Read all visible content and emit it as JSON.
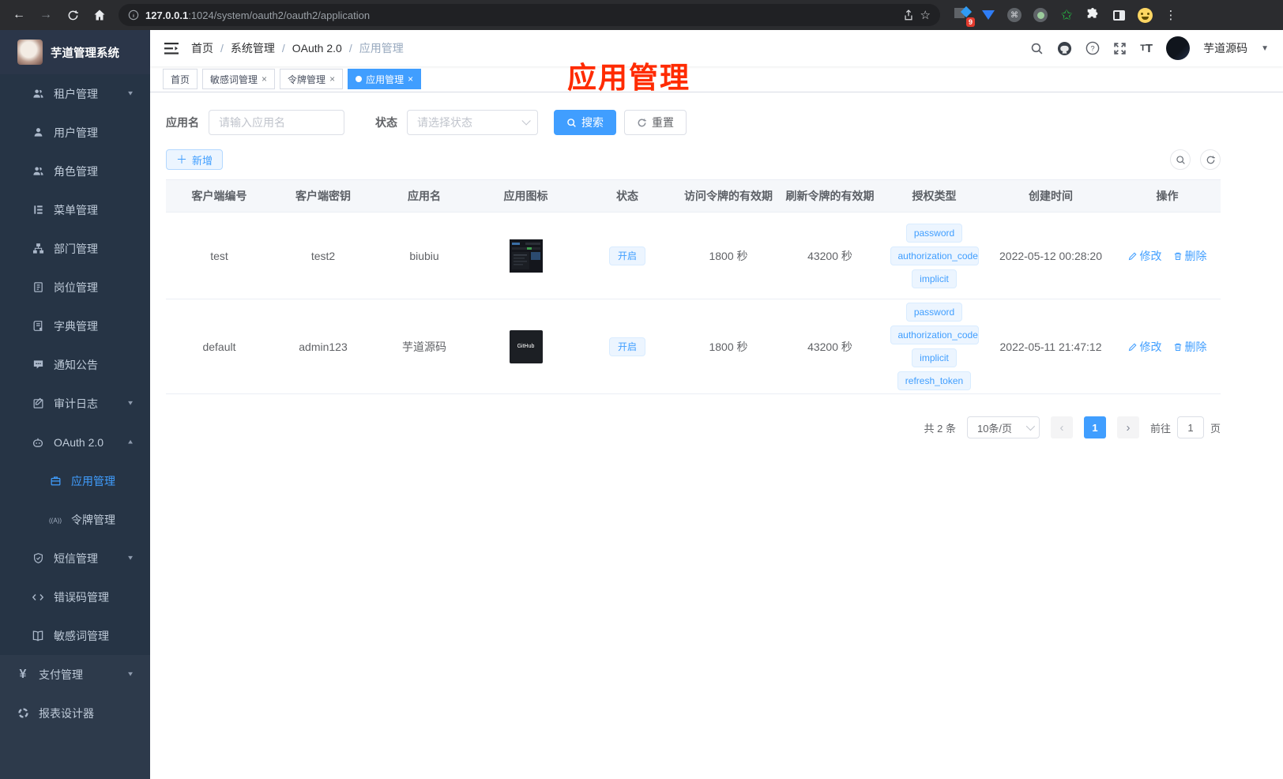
{
  "browser": {
    "url_host": "127.0.0.1",
    "url_path": ":1024/system/oauth2/oauth2/application",
    "extension_badge": "9"
  },
  "app_title": "芋道管理系统",
  "sidebar": {
    "items": [
      {
        "label": "租户管理",
        "icon": "tenant",
        "arrow": "down"
      },
      {
        "label": "用户管理",
        "icon": "user"
      },
      {
        "label": "角色管理",
        "icon": "role"
      },
      {
        "label": "菜单管理",
        "icon": "menu"
      },
      {
        "label": "部门管理",
        "icon": "dept"
      },
      {
        "label": "岗位管理",
        "icon": "post"
      },
      {
        "label": "字典管理",
        "icon": "dict"
      },
      {
        "label": "通知公告",
        "icon": "notice"
      },
      {
        "label": "审计日志",
        "icon": "audit",
        "arrow": "down"
      },
      {
        "label": "OAuth 2.0",
        "icon": "oauth",
        "arrow": "up"
      },
      {
        "label": "应用管理",
        "icon": "application",
        "active": true
      },
      {
        "label": "令牌管理",
        "icon": "token"
      },
      {
        "label": "短信管理",
        "icon": "sms",
        "arrow": "down"
      },
      {
        "label": "错误码管理",
        "icon": "errcode"
      },
      {
        "label": "敏感词管理",
        "icon": "sensitive"
      },
      {
        "label": "支付管理",
        "icon": "pay",
        "arrow": "down"
      },
      {
        "label": "报表设计器",
        "icon": "report"
      }
    ]
  },
  "breadcrumb": [
    "首页",
    "系统管理",
    "OAuth 2.0",
    "应用管理"
  ],
  "header": {
    "username": "芋道源码"
  },
  "tabs": [
    {
      "label": "首页",
      "closable": false,
      "active": false
    },
    {
      "label": "敏感词管理",
      "closable": true,
      "active": false
    },
    {
      "label": "令牌管理",
      "closable": true,
      "active": false
    },
    {
      "label": "应用管理",
      "closable": true,
      "active": true
    }
  ],
  "annotation_text": "应用管理",
  "filters": {
    "app_name_label": "应用名",
    "app_name_placeholder": "请输入应用名",
    "status_label": "状态",
    "status_placeholder": "请选择状态",
    "search_label": "搜索",
    "reset_label": "重置",
    "add_label": "新增"
  },
  "table": {
    "columns": [
      "客户端编号",
      "客户端密钥",
      "应用名",
      "应用图标",
      "状态",
      "访问令牌的有效期",
      "刷新令牌的有效期",
      "授权类型",
      "创建时间",
      "操作"
    ],
    "rows": [
      {
        "client_id": "test",
        "secret": "test2",
        "name": "biubiu",
        "status": "开启",
        "access_validity": "1800 秒",
        "refresh_validity": "43200 秒",
        "grant_types": [
          "password",
          "authorization_code",
          "implicit"
        ],
        "created": "2022-05-12 00:28:20"
      },
      {
        "client_id": "default",
        "secret": "admin123",
        "name": "芋道源码",
        "icon_text": "GitHub",
        "status": "开启",
        "access_validity": "1800 秒",
        "refresh_validity": "43200 秒",
        "grant_types": [
          "password",
          "authorization_code",
          "implicit",
          "refresh_token"
        ],
        "created": "2022-05-11 21:47:12"
      }
    ],
    "edit_label": "修改",
    "delete_label": "删除"
  },
  "pagination": {
    "total": "共 2 条",
    "page_size": "10条/页",
    "current": "1",
    "goto_label": "前往",
    "goto_value": "1",
    "page_label": "页"
  },
  "colors": {
    "accent": "#409eff",
    "annotation": "#ff2b00",
    "sidebar_bg": "#2d3a4b",
    "submenu_bg": "#263445"
  }
}
